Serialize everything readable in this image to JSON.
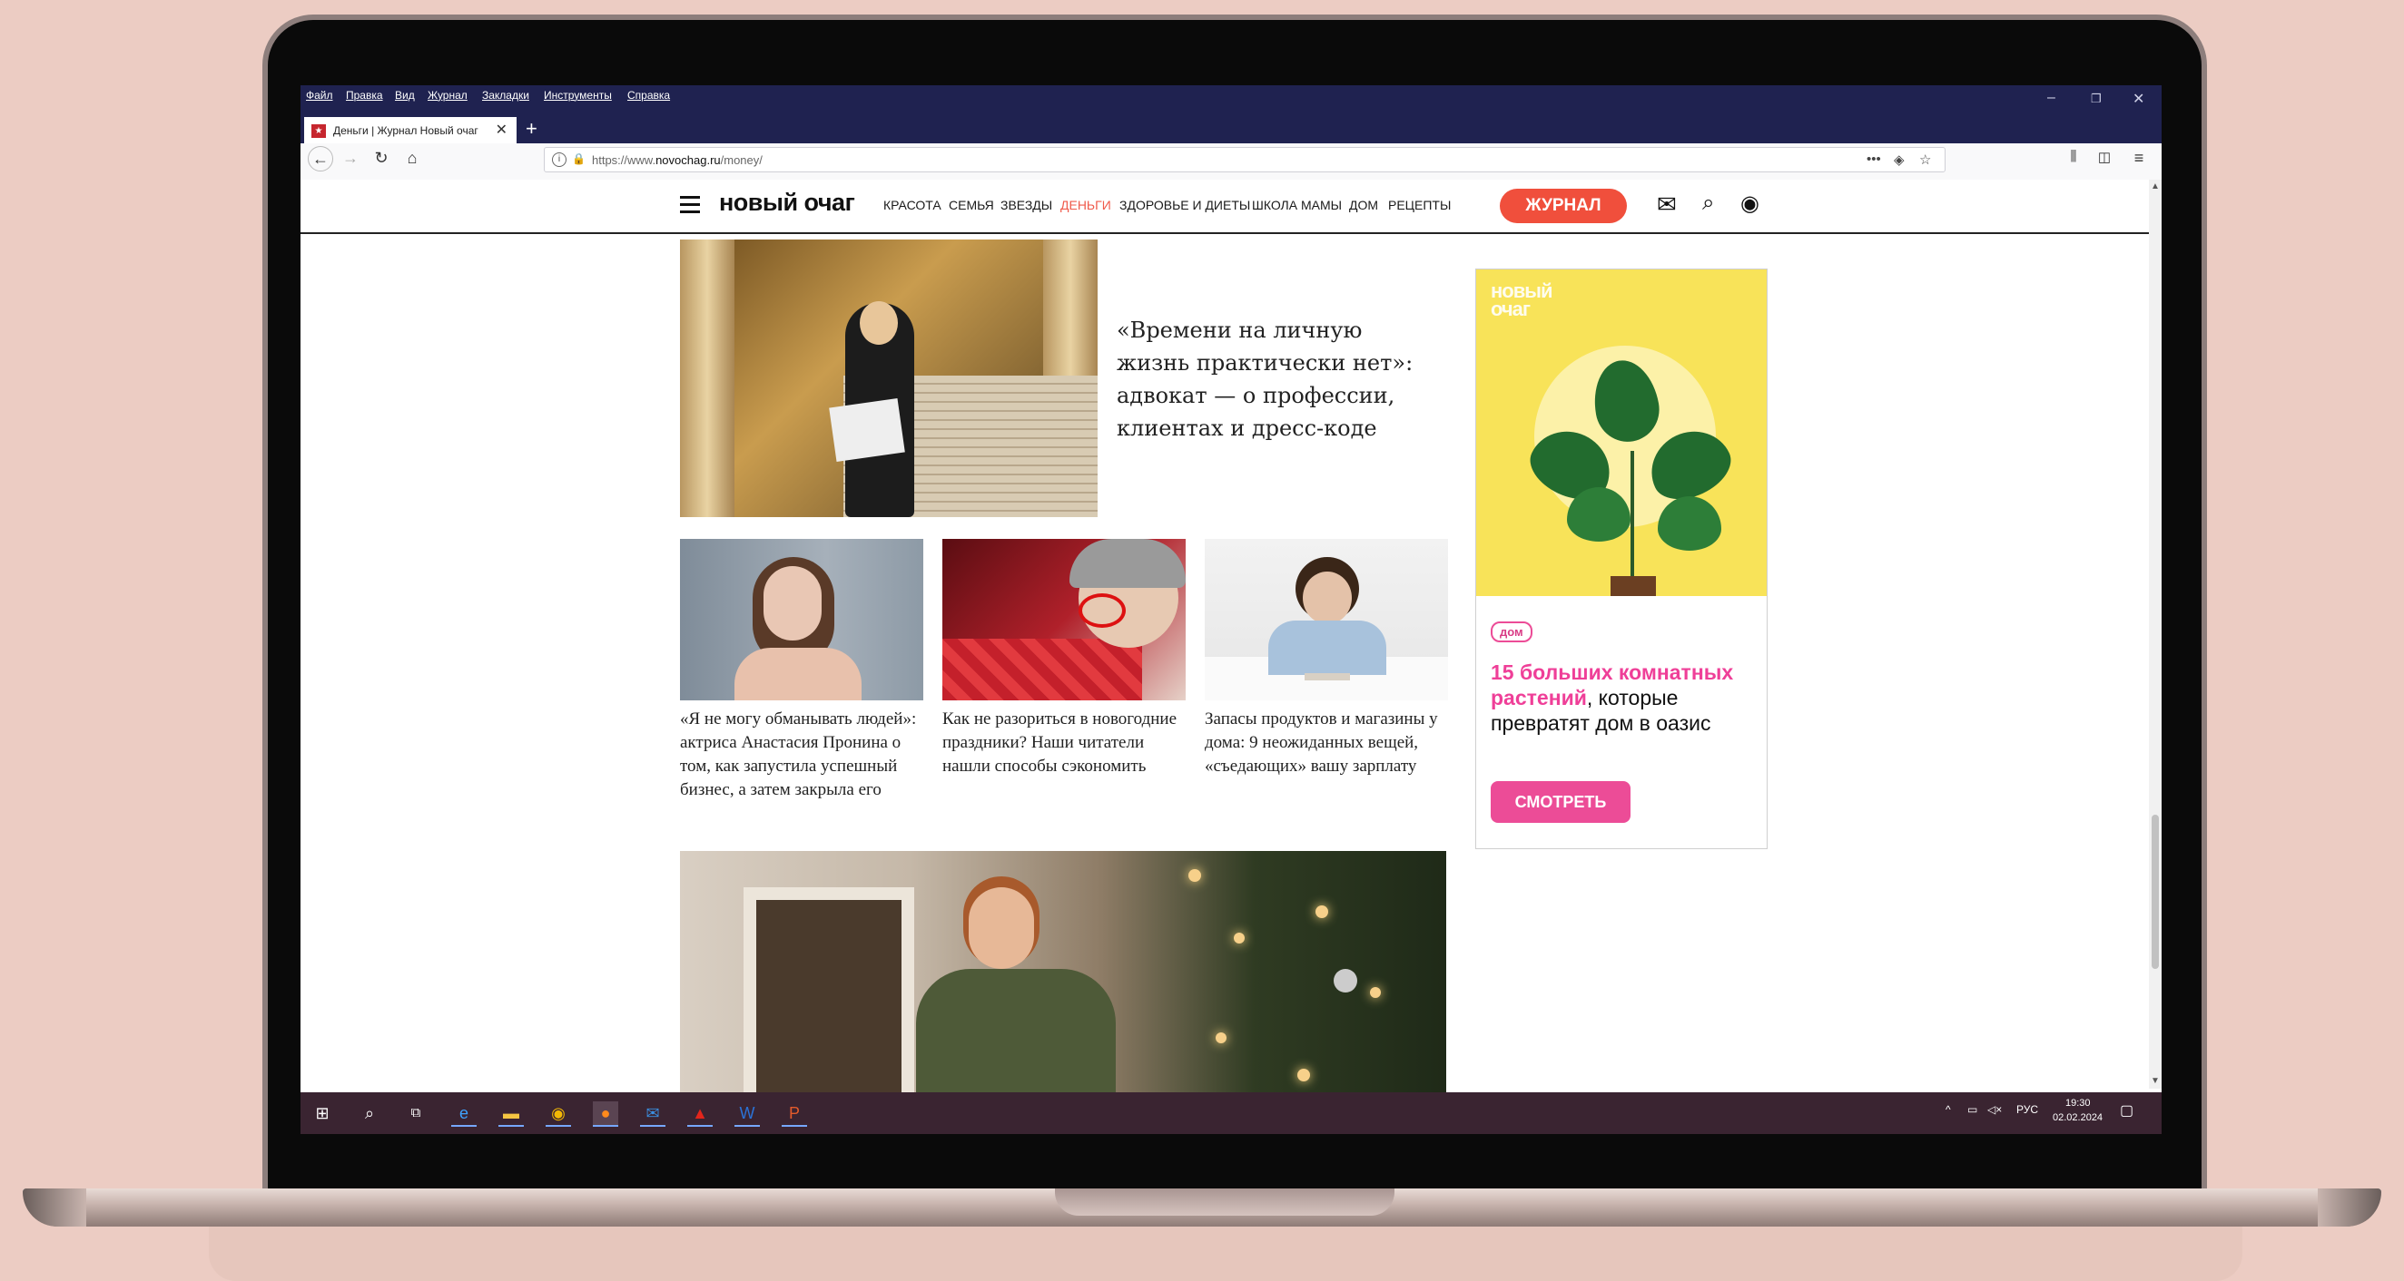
{
  "browser": {
    "menu": [
      "Файл",
      "Правка",
      "Вид",
      "Журнал",
      "Закладки",
      "Инструменты",
      "Справка"
    ],
    "tab_title": "Деньги | Журнал Новый очаг",
    "url_prefix": "https://www.",
    "url_domain": "novochag.ru",
    "url_path": "/money/"
  },
  "site": {
    "logo": "новый очаг",
    "nav": [
      "КРАСОТА",
      "СЕМЬЯ",
      "ЗВЕЗДЫ",
      "ДЕНЬГИ",
      "ЗДОРОВЬЕ И ДИЕТЫ",
      "ШКОЛА МАМЫ",
      "ДОМ",
      "РЕЦЕПТЫ"
    ],
    "active_nav": "ДЕНЬГИ",
    "journal_button": "ЖУРНАЛ"
  },
  "hero": {
    "title": "«Времени на личную жизнь практически нет»: адвокат — о профессии, клиентах и дресс-коде"
  },
  "cards": [
    {
      "caption": "«Я не могу обманывать людей»: актриса Анастасия Пронина о том, как запустила успешный бизнес, а затем закрыла его"
    },
    {
      "caption": "Как не разориться в новогодние праздники? Наши читатели нашли способы сэкономить"
    },
    {
      "caption": "Запасы продуктов и магазины у дома: 9 неожиданных вещей, «съедающих» вашу зарплату"
    }
  ],
  "ad": {
    "brand": "новый очаг",
    "tag": "дом",
    "headline_bold": "15 больших комнатных растений",
    "headline_rest": ", которые превратят дом в оазис",
    "button": "СМОТРЕТЬ"
  },
  "taskbar": {
    "lang": "РУС",
    "time": "19:30",
    "date": "02.02.2024"
  }
}
